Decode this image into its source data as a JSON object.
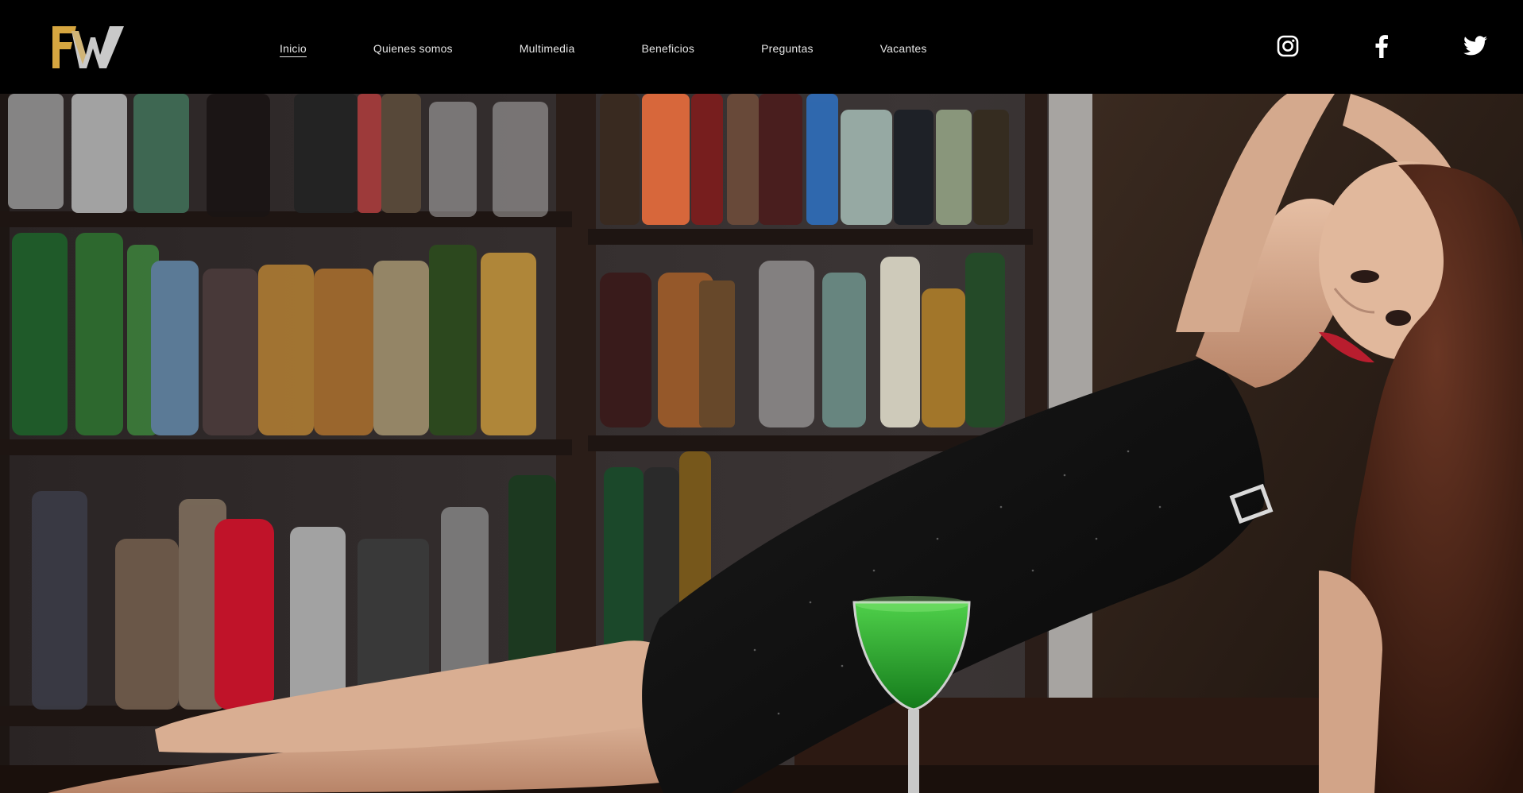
{
  "brand": {
    "logo_text": "FW",
    "gold": "#d6a640",
    "silver": "#bdbdbd"
  },
  "nav": {
    "items": [
      {
        "label": "Inicio",
        "active": true
      },
      {
        "label": "Quienes somos"
      },
      {
        "label": "Multimedia"
      },
      {
        "label": "Beneficios"
      },
      {
        "label": "Preguntas"
      },
      {
        "label": "Vacantes"
      }
    ]
  },
  "social": [
    "instagram-icon",
    "facebook-icon",
    "twitter-icon"
  ],
  "hero": {
    "image": "bar-shelves-with-bottles-and-woman-in-black-dress-reclining-with-green-cocktail"
  }
}
